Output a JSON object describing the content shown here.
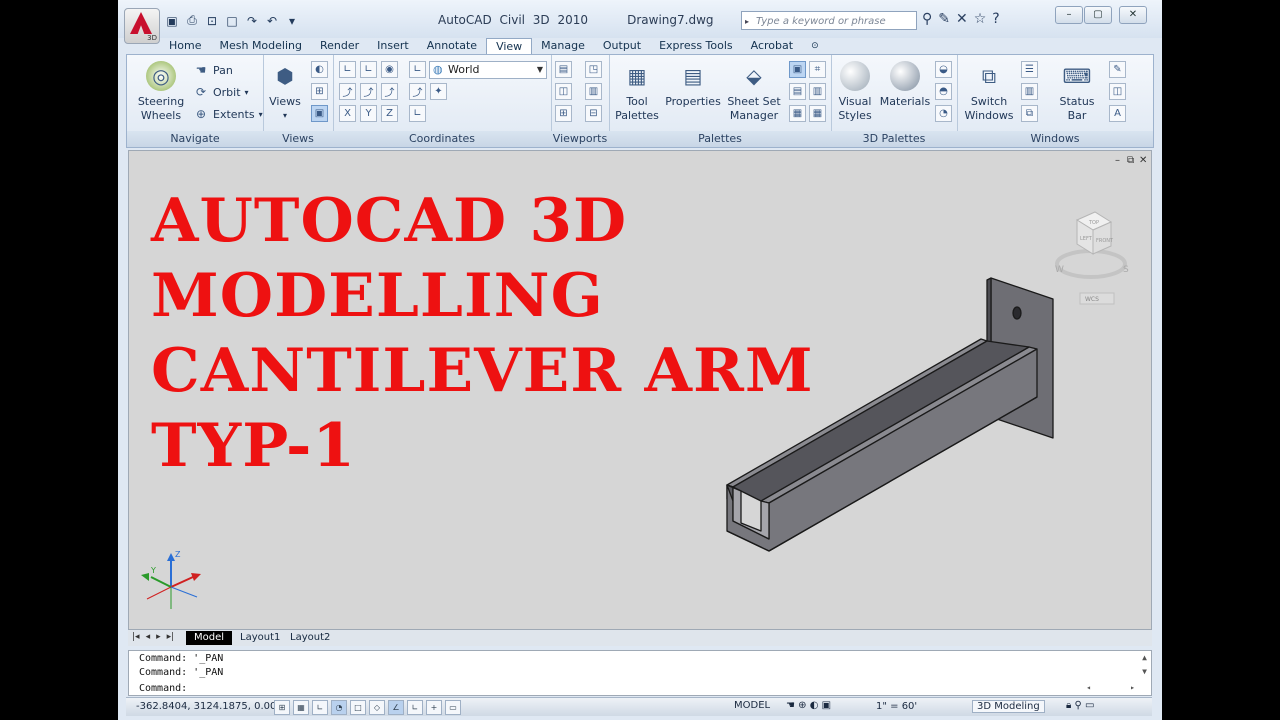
{
  "title_bar": {
    "app_title": "AutoCAD Civil 3D 2010",
    "file_name": "Drawing7.dwg",
    "search_placeholder": "Type a keyword or phrase",
    "app_badge": "3D"
  },
  "tabs": [
    {
      "label": "Home"
    },
    {
      "label": "Mesh Modeling"
    },
    {
      "label": "Render"
    },
    {
      "label": "Insert"
    },
    {
      "label": "Annotate"
    },
    {
      "label": "View"
    },
    {
      "label": "Manage"
    },
    {
      "label": "Output"
    },
    {
      "label": "Express Tools"
    },
    {
      "label": "Acrobat"
    }
  ],
  "active_tab": "View",
  "ribbon": {
    "navigate": {
      "title": "Navigate",
      "steering_wheels": "Steering\nWheels",
      "pan": "Pan",
      "orbit": "Orbit",
      "extents": "Extents"
    },
    "views": {
      "title": "Views",
      "views_button": "Views"
    },
    "coordinates": {
      "title": "Coordinates",
      "ucs_combo": "World"
    },
    "viewports": {
      "title": "Viewports"
    },
    "palettes": {
      "title": "Palettes",
      "tool_palettes": "Tool\nPalettes",
      "properties": "Properties",
      "sheet_set_manager": "Sheet Set\nManager"
    },
    "palettes_3d": {
      "title": "3D Palettes",
      "visual_styles": "Visual\nStyles",
      "materials": "Materials"
    },
    "windows": {
      "title": "Windows",
      "switch_windows": "Switch\nWindows",
      "status_bar": "Status\nBar"
    }
  },
  "drawing": {
    "heading_lines": [
      "AUTOCAD 3D",
      "MODELLING",
      "CANTILEVER ARM",
      "TYP-1"
    ],
    "viewcube": {
      "top": "TOP",
      "left": "LEFT",
      "front": "FRONT",
      "compass_w": "W",
      "compass_s": "S",
      "wcs": "WCS"
    },
    "ucs_axis_z": "Z",
    "ucs_axis_y": "Y"
  },
  "layout_tabs": [
    {
      "label": "Model"
    },
    {
      "label": "Layout1"
    },
    {
      "label": "Layout2"
    }
  ],
  "active_layout": "Model",
  "command_lines": [
    "Command: '_PAN",
    "Command: '_PAN",
    "Command:"
  ],
  "status_bar": {
    "coordinates": "-362.8404, 3124.1875, 0.0000",
    "space": "MODEL",
    "annotation_scale": "1\" = 60'",
    "workspace": "3D Modeling"
  },
  "colors": {
    "heading": "#ee1111",
    "drawing_bg": "#d6d6d6",
    "ribbon_bg": "#dfe8f3"
  }
}
